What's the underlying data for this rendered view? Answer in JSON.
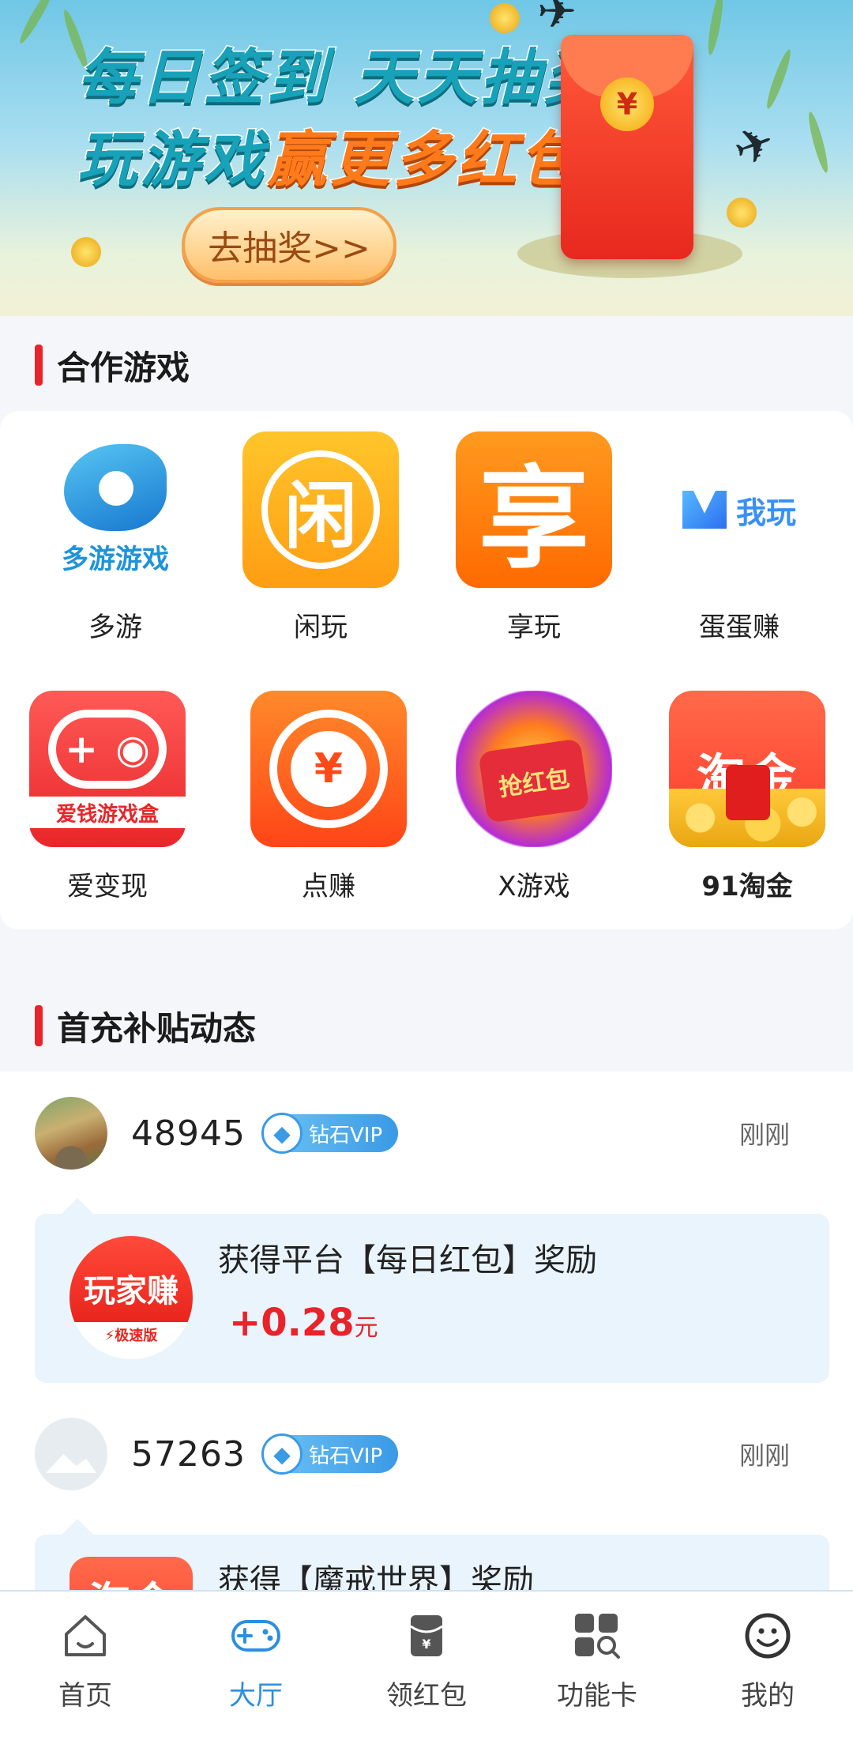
{
  "banner": {
    "line1": "每日签到 天天抽奖",
    "line2a": "玩游戏",
    "line2b": "赢更多红包",
    "cta": "去抽奖>>",
    "envelope_symbol": "¥"
  },
  "games_section": {
    "title": "合作游戏",
    "games": [
      {
        "label": "多游",
        "icon": "duoyou-icon",
        "icon_text": "多游游戏"
      },
      {
        "label": "闲玩",
        "icon": "xianwan-icon",
        "icon_text": "闲"
      },
      {
        "label": "享玩",
        "icon": "xiangwan-icon",
        "icon_text": "享"
      },
      {
        "label": "蛋蛋赚",
        "icon": "wowan-icon",
        "icon_text": "我玩"
      },
      {
        "label": "爱变现",
        "icon": "aibianxian-icon",
        "icon_text": "爱钱游戏盒"
      },
      {
        "label": "点赚",
        "icon": "dianzhuan-icon",
        "icon_text": "¥"
      },
      {
        "label": "X游戏",
        "icon": "hongbao-icon",
        "icon_text": "抢红包"
      },
      {
        "label": "91淘金",
        "icon": "taojin-icon",
        "icon_text": "淘金"
      }
    ]
  },
  "feed_section": {
    "title": "首充补贴动态",
    "items": [
      {
        "user_id": "48945",
        "vip": "钻石VIP",
        "time": "刚刚",
        "message": "获得平台【每日红包】奖励",
        "amount": "+0.28",
        "unit": "元",
        "logo_text": "玩家赚",
        "logo_sub": "⚡极速版"
      },
      {
        "user_id": "57263",
        "vip": "钻石VIP",
        "time": "刚刚",
        "message": "获得【魔戒世界】奖励",
        "logo_text": "淘金"
      }
    ]
  },
  "bottom_nav": {
    "items": [
      {
        "label": "首页",
        "icon": "home-icon"
      },
      {
        "label": "大厅",
        "icon": "gamepad-icon",
        "active": true
      },
      {
        "label": "领红包",
        "icon": "red-envelope-icon"
      },
      {
        "label": "功能卡",
        "icon": "grid-search-icon"
      },
      {
        "label": "我的",
        "icon": "smiley-icon"
      }
    ],
    "active_color": "#2b8fe0"
  }
}
